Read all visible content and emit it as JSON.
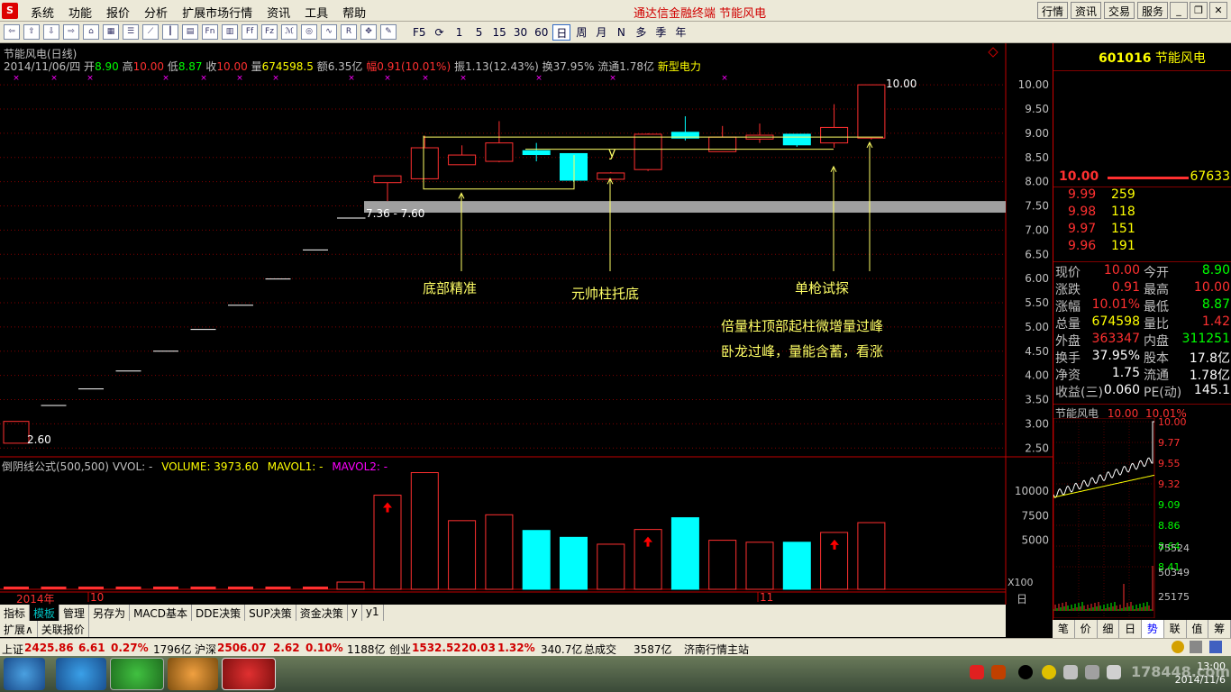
{
  "menubar": {
    "items": [
      "系统",
      "功能",
      "报价",
      "分析",
      "扩展市场行情",
      "资讯",
      "工具",
      "帮助"
    ],
    "center_title": "通达信金融终端   节能风电",
    "right_buttons": [
      "行情",
      "资讯",
      "交易",
      "服务"
    ]
  },
  "toolbar": {
    "periods": [
      "F5",
      "",
      "1",
      "5",
      "15",
      "30",
      "60",
      "日",
      "周",
      "月",
      "N",
      "多",
      "季",
      "年"
    ],
    "active_period": "日"
  },
  "chart": {
    "title": "节能风电(日线)",
    "quote": {
      "date": "2014/11/06/四",
      "open_label": "开",
      "open": "8.90",
      "high_label": "高",
      "high": "10.00",
      "low_label": "低",
      "low": "8.87",
      "close_label": "收",
      "close": "10.00",
      "volume_label": "量",
      "volume": "674598.5",
      "amount_label": "额",
      "amount": "6.35亿",
      "change_label": "幅",
      "change": "0.91(10.01%)",
      "amplitude_label": "振",
      "amplitude": "1.13(12.43%)",
      "turnover_label": "换",
      "turnover": "37.95%",
      "float_label": "流通",
      "float": "1.78亿",
      "sector": "新型电力"
    },
    "price_labels": [
      "10.00",
      "9.50",
      "9.00",
      "8.50",
      "8.00",
      "7.50",
      "7.00",
      "6.50",
      "6.00",
      "5.50",
      "5.00",
      "4.50",
      "4.00",
      "3.50",
      "3.00",
      "2.50"
    ],
    "high_mark": "10.00",
    "low_mark": "2.60",
    "zone_label": "7.36 - 7.60",
    "annotations": {
      "bottom_precise": "底部精准",
      "marshal_pillar": "元帅柱托底",
      "single_gun": "单枪试探",
      "double_volume_1": "倍量柱顶部起柱微增量过峰",
      "double_volume_2": "卧龙过峰，量能含蓄，看涨",
      "y_mark": "y"
    },
    "x_labels": [
      "2014年",
      "10",
      "11"
    ]
  },
  "chart_data": {
    "type": "candlestick",
    "series_flat": [
      2.6,
      3.38,
      3.72,
      4.09,
      4.5,
      4.95,
      5.45,
      5.99,
      6.59,
      7.25
    ],
    "candles": [
      {
        "o": 7.98,
        "h": 8.12,
        "l": 7.6,
        "c": 8.12
      },
      {
        "o": 8.06,
        "h": 8.95,
        "l": 8.06,
        "c": 8.7
      },
      {
        "o": 8.35,
        "h": 8.75,
        "l": 8.35,
        "c": 8.55
      },
      {
        "o": 8.42,
        "h": 9.25,
        "l": 8.4,
        "c": 8.8
      },
      {
        "o": 8.64,
        "h": 8.8,
        "l": 8.42,
        "c": 8.56
      },
      {
        "o": 8.58,
        "h": 8.58,
        "l": 8.0,
        "c": 8.03
      },
      {
        "o": 8.05,
        "h": 8.2,
        "l": 8.05,
        "c": 8.18
      },
      {
        "o": 8.25,
        "h": 9.0,
        "l": 8.22,
        "c": 8.98
      },
      {
        "o": 9.02,
        "h": 9.35,
        "l": 8.85,
        "c": 8.9
      },
      {
        "o": 8.62,
        "h": 9.15,
        "l": 8.62,
        "c": 8.92
      },
      {
        "o": 8.88,
        "h": 9.2,
        "l": 8.8,
        "c": 8.96
      },
      {
        "o": 8.98,
        "h": 8.98,
        "l": 8.72,
        "c": 8.76
      },
      {
        "o": 8.8,
        "h": 9.6,
        "l": 8.7,
        "c": 9.12
      },
      {
        "o": 8.9,
        "h": 10.0,
        "l": 8.87,
        "c": 10.0
      }
    ],
    "ylim": [
      2.3,
      10.3
    ],
    "volume": [
      0,
      0,
      0,
      0,
      0,
      0,
      0,
      0,
      0,
      180,
      9600,
      11900,
      7000,
      7600,
      6000,
      5300,
      4600,
      6100,
      7300,
      5000,
      4800,
      4800,
      5800,
      6800
    ],
    "volume_ticks": [
      "10000",
      "7500",
      "5000"
    ],
    "vol_ylim": [
      0,
      12500
    ]
  },
  "volume_header": {
    "formula": "倒阴线公式(500,500)",
    "vvol": "VVOL: -",
    "volume": "VOLUME: 3973.60",
    "mavol1": "MAVOL1: -",
    "mavol2": "MAVOL2: -",
    "scale": "X100"
  },
  "tabs_row1": [
    "指标",
    "模板",
    "管理",
    "另存为",
    "MACD基本",
    "DDE决策",
    "SUP决策",
    "资金决策",
    "y",
    "y1"
  ],
  "tabs_row2": [
    "扩展∧",
    "关联报价"
  ],
  "right_panel": {
    "code": "601016",
    "name": "节能风电",
    "ask_price": "10.00",
    "ask_volume": "67633",
    "bids": [
      {
        "p": "9.99",
        "v": "259"
      },
      {
        "p": "9.98",
        "v": "118"
      },
      {
        "p": "9.97",
        "v": "151"
      },
      {
        "p": "9.96",
        "v": "191"
      }
    ],
    "stats": [
      {
        "l": "现价",
        "v": "10.00",
        "l2": "今开",
        "v2": "8.90",
        "c1": "#ff3030",
        "c2": "#00ff00"
      },
      {
        "l": "涨跌",
        "v": "0.91",
        "l2": "最高",
        "v2": "10.00",
        "c1": "#ff3030",
        "c2": "#ff3030"
      },
      {
        "l": "涨幅",
        "v": "10.01%",
        "l2": "最低",
        "v2": "8.87",
        "c1": "#ff3030",
        "c2": "#00ff00"
      },
      {
        "l": "总量",
        "v": "674598",
        "l2": "量比",
        "v2": "1.42",
        "c1": "#ffff00",
        "c2": "#ff3030"
      },
      {
        "l": "外盘",
        "v": "363347",
        "l2": "内盘",
        "v2": "311251",
        "c1": "#ff3030",
        "c2": "#00ff00"
      },
      {
        "l": "换手",
        "v": "37.95%",
        "l2": "股本",
        "v2": "17.8亿",
        "c1": "#ffffff",
        "c2": "#ffffff"
      },
      {
        "l": "净资",
        "v": "1.75",
        "l2": "流通",
        "v2": "1.78亿",
        "c1": "#ffffff",
        "c2": "#ffffff"
      },
      {
        "l": "收益(三)",
        "v": "0.060",
        "l2": "PE(动)",
        "v2": "145.1",
        "c1": "#ffffff",
        "c2": "#ffffff"
      }
    ],
    "mini_title": "节能风电",
    "mini_price": "10.00",
    "mini_pct": "10.01%",
    "mini_prices": [
      "10.00",
      "9.77",
      "9.55",
      "9.32",
      "9.09",
      "8.86",
      "8.64",
      "8.41"
    ],
    "mini_vols": [
      "75524",
      "50349",
      "25175"
    ],
    "tabs": [
      "笔",
      "价",
      "细",
      "日",
      "势",
      "联",
      "值",
      "筹"
    ],
    "active_tab": "势"
  },
  "statusbar": {
    "sh_label": "上证",
    "sh": "2425.86",
    "sh_chg": "6.61",
    "sh_pct": "0.27%",
    "sh_amt": "1796亿",
    "hs_label": "沪深",
    "hs": "2506.07",
    "hs_chg": "2.62",
    "hs_pct": "0.10%",
    "hs_amt": "1188亿",
    "cy_label": "创业",
    "cy": "1532.52",
    "cy_chg": "20.03",
    "cy_pct": "1.32%",
    "cy_amt": "340.7亿",
    "total_label": "总成交",
    "total": "3587亿",
    "station": "济南行情主站"
  },
  "taskbar": {
    "watermark": "178448.com",
    "time": "13:00",
    "date": "2014/11/6"
  },
  "colors": {
    "up": "#ff3030",
    "down": "#00ffff",
    "annotation": "#ffff66",
    "grid": "#800000"
  }
}
